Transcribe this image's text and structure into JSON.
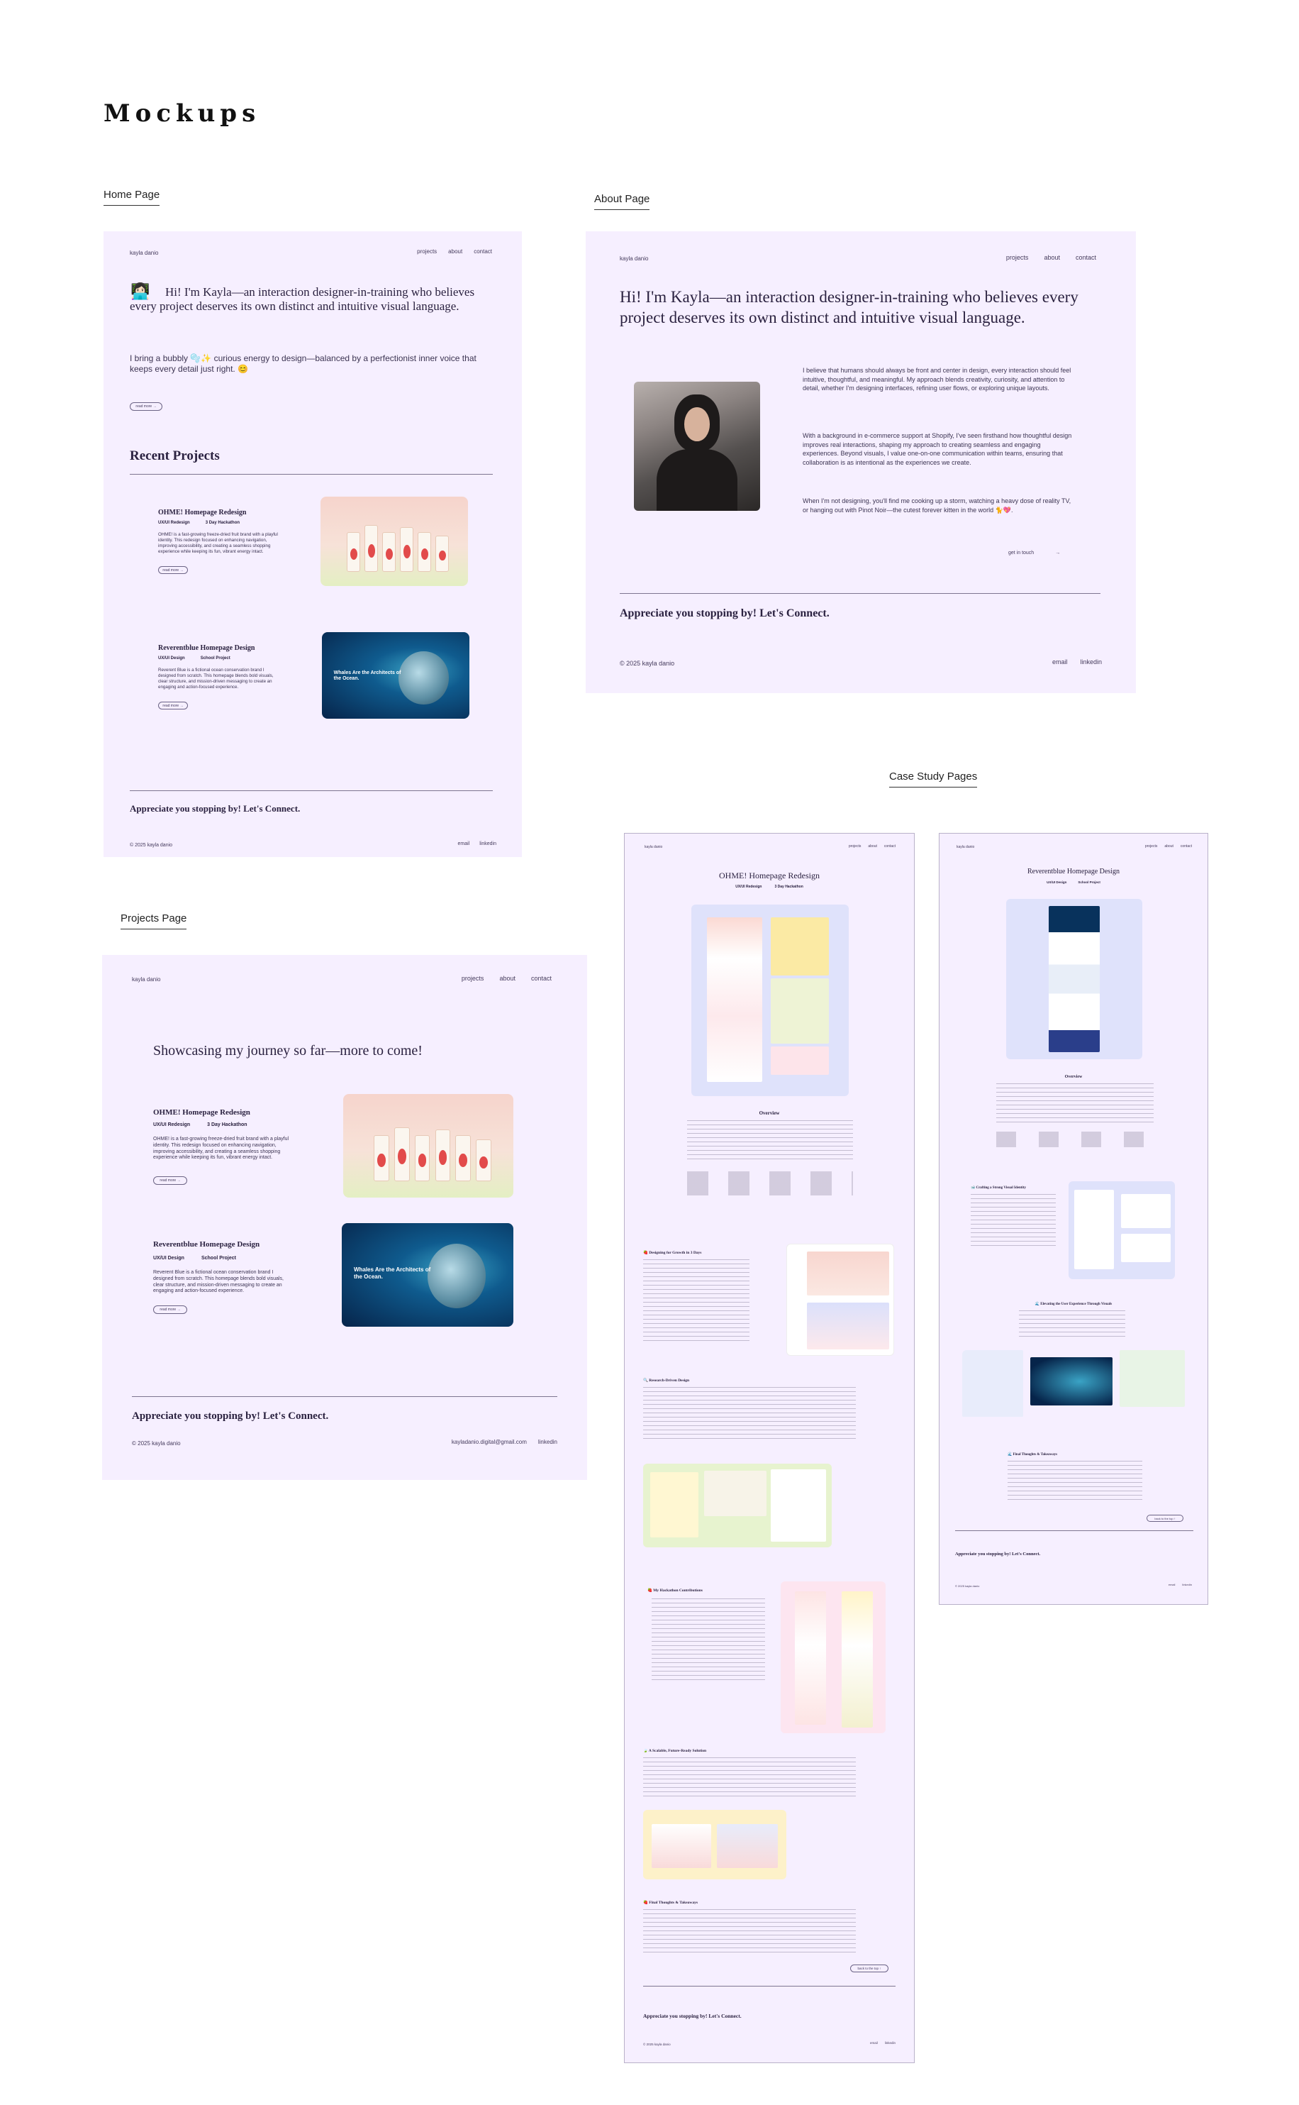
{
  "page_title": "Mockups",
  "labels": {
    "home": "Home Page",
    "about": "About Page",
    "projects": "Projects Page",
    "case": "Case Study Pages"
  },
  "site": {
    "brand": "kayla danio",
    "nav": [
      "projects",
      "about",
      "contact"
    ],
    "copyright": "© 2025 kayla danio",
    "footer_links": [
      "email",
      "linkedin"
    ],
    "footer_email": "kayladanio.digital@gmail.com",
    "cta": "Appreciate you stopping by! Let's Connect."
  },
  "home": {
    "avatar_emoji": "👩🏻‍💻",
    "hero": "Hi! I'm Kayla—an interaction designer-in-training who believes every project deserves its own distinct and intuitive visual language.",
    "sub": "I bring a bubbly 🫧✨ curious energy to design—balanced by a perfectionist inner voice that keeps every detail just right. 😊",
    "read_more": "read more →",
    "recent": "Recent Projects"
  },
  "projects": [
    {
      "title": "OHME! Homepage Redesign",
      "tags": [
        "UX/UI Redesign",
        "3 Day Hackathon"
      ],
      "desc": "OHME! is a fast-growing freeze-dried fruit brand with a playful identity. This redesign focused on enhancing navigation, improving accessibility, and creating a seamless shopping experience while keeping its fun, vibrant energy intact.",
      "button": "read more →"
    },
    {
      "title": "Reverentblue Homepage Design",
      "tags": [
        "UX/UI Design",
        "School Project"
      ],
      "desc": "Reverent Blue is a fictional ocean conservation brand I designed from scratch. This homepage blends bold visuals, clear structure, and mission-driven messaging to create an engaging and action-focused experience.",
      "button": "read more →",
      "thumb_title": "Whales Are the Architects of the Ocean."
    }
  ],
  "about": {
    "hero": "Hi! I'm Kayla—an interaction designer-in-training who believes every project deserves its own distinct and intuitive visual language.",
    "p1": "I believe that humans should always be front and center in design, every interaction should feel intuitive, thoughtful, and meaningful. My approach blends creativity, curiosity, and attention to detail, whether I'm designing interfaces, refining user flows, or exploring unique layouts.",
    "p2": "With a background in e-commerce support at Shopify, I've seen firsthand how thoughtful design improves real interactions, shaping my approach to creating seamless and engaging experiences. Beyond visuals, I value one-on-one communication within teams, ensuring that collaboration is as intentional as the experiences we create.",
    "p3": "When I'm not designing, you'll find me cooking up a storm, watching a heavy dose of reality TV, or hanging out with Pinot Noir—the cutest forever kitten in the world 🐈💖.",
    "get_in_touch": "get in touch",
    "arrow": "→"
  },
  "projects_page": {
    "heading": "Showcasing my journey so far—more to come!"
  },
  "case_ohme": {
    "title": "OHME! Homepage Redesign",
    "tags": [
      "UX/UI Redesign",
      "3 Day Hackathon"
    ],
    "overview": "Overview",
    "sections": [
      "🍓 Designing for Growth in 3 Days",
      "🔍 Research-Driven Design",
      "🍓 My Hackathon Contributions",
      "🍃 A Scalable, Future-Ready Solution",
      "🍓 Final Thoughts & Takeaways"
    ],
    "back": "back to the top ↑"
  },
  "case_rb": {
    "title": "Reverentblue Homepage Design",
    "tags": [
      "UX/UI Design",
      "School Project"
    ],
    "overview": "Overview",
    "sections": [
      "🐋 Crafting a Strong Visual Identity",
      "🌊 Elevating the User Experience Through Visuals",
      "🌊 Final Thoughts & Takeaways"
    ],
    "back": "back to the top ↑"
  },
  "colors": {
    "mock_bg": "#f6efff",
    "text": "#2b2240",
    "accent_red": "#e24b4b",
    "ocean": "#0f5b8e"
  }
}
